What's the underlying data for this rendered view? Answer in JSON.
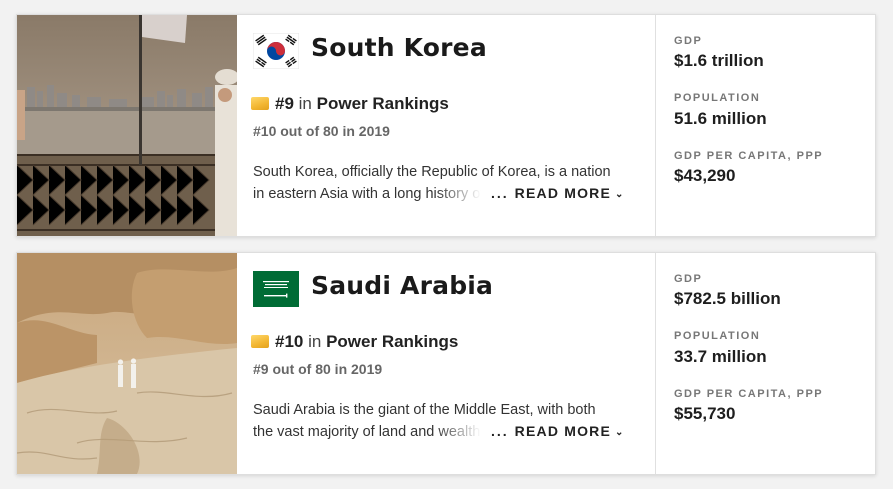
{
  "countries": [
    {
      "name": "South Korea",
      "rank": "#9",
      "in_text": "in",
      "rankings_label": "Power Rankings",
      "previous": "#10 out of 80 in 2019",
      "description_line1": "South Korea, officially the Republic of Korea, is a nation",
      "description_line2": "in eastern Asia with a long history of",
      "read_more": "READ MORE",
      "dots": "...",
      "stats": [
        {
          "label": "GDP",
          "value": "$1.6 trillion"
        },
        {
          "label": "POPULATION",
          "value": "51.6 million"
        },
        {
          "label": "GDP PER CAPITA, PPP",
          "value": "$43,290"
        }
      ]
    },
    {
      "name": "Saudi Arabia",
      "rank": "#10",
      "in_text": "in",
      "rankings_label": "Power Rankings",
      "previous": "#9 out of 80 in 2019",
      "description_line1": "Saudi Arabia is the giant of the Middle East, with both",
      "description_line2": "the vast majority of land and wealth",
      "read_more": "READ MORE",
      "dots": "...",
      "stats": [
        {
          "label": "GDP",
          "value": "$782.5 billion"
        },
        {
          "label": "POPULATION",
          "value": "33.7 million"
        },
        {
          "label": "GDP PER CAPITA, PPP",
          "value": "$55,730"
        }
      ]
    }
  ],
  "colors": {
    "medal": "#f2b632",
    "korea_red": "#cd2e3a",
    "korea_blue": "#0047a0",
    "saudi_green": "#006c35"
  }
}
